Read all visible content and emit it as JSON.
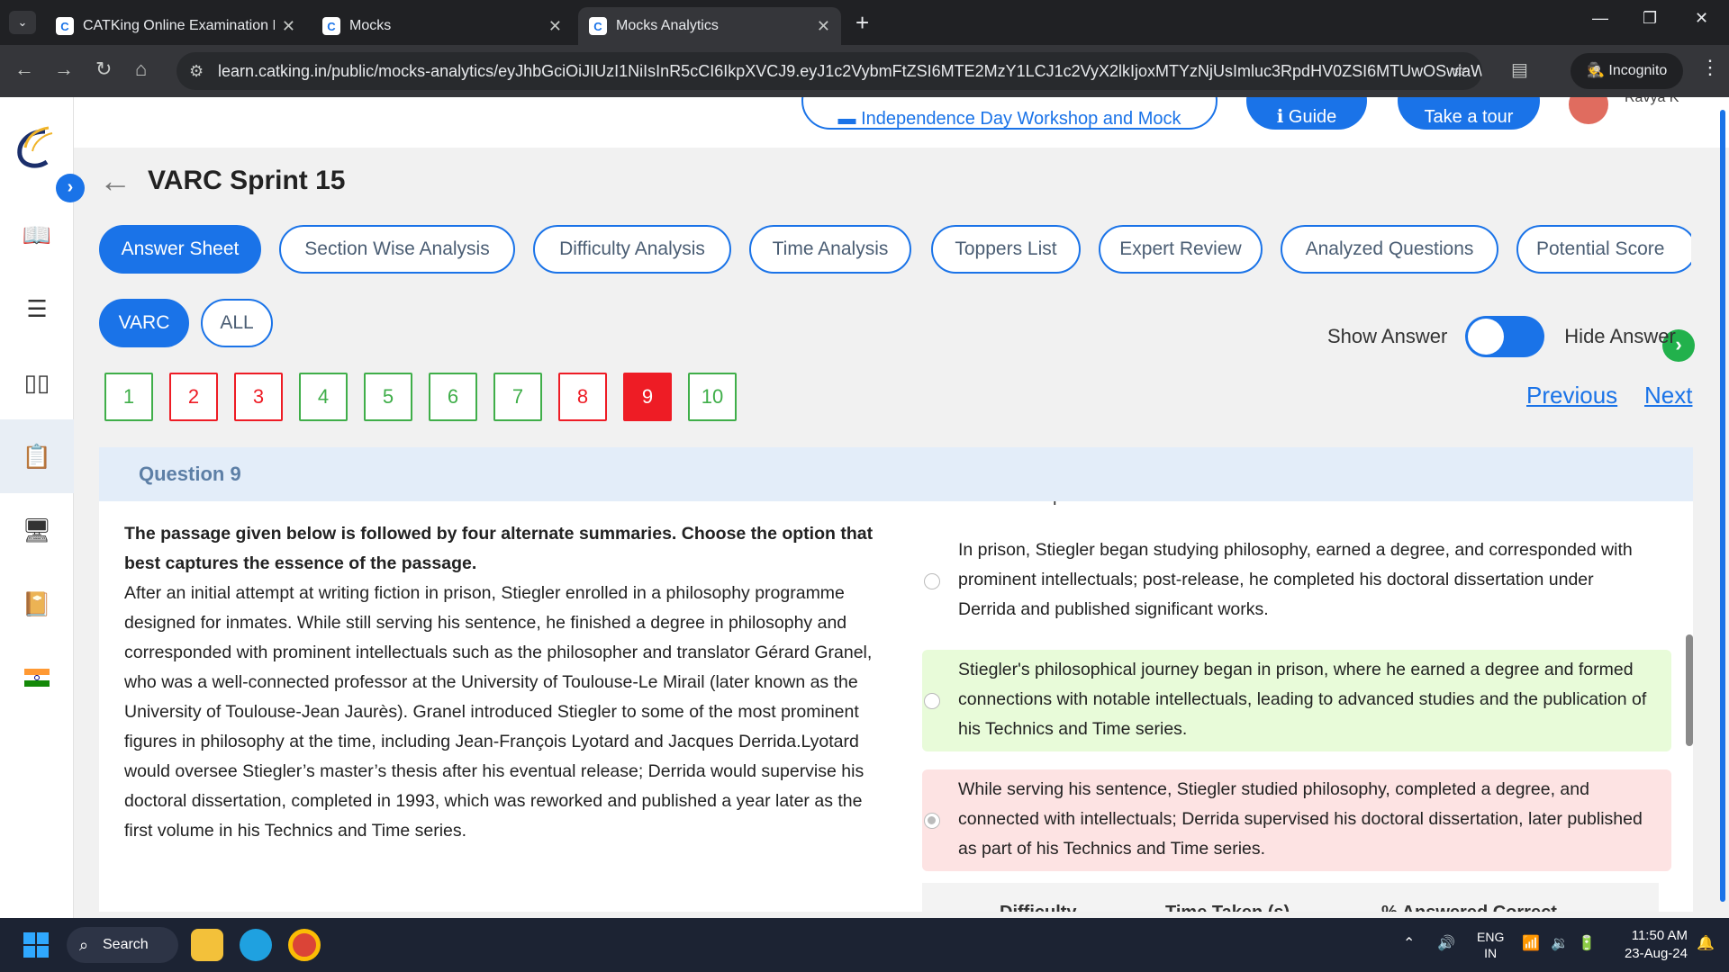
{
  "browser": {
    "tabs": [
      {
        "title": "CATKing Online Examination Pl",
        "active": false
      },
      {
        "title": "Mocks",
        "active": false
      },
      {
        "title": "Mocks Analytics",
        "active": true
      }
    ],
    "url": "learn.catking.in/public/mocks-analytics/eyJhbGciOiJIUzI1NiIsInR5cCI6IkpXVCJ9.eyJ1c2VybmFtZSI6MTE2MzY1LCJ1c2VyX2lkIjoxMTYzNjUsImluc3RpdHV0ZSI6MTUwOSwiaWQiO...",
    "mode_label": "Incognito"
  },
  "top_buttons": {
    "workshop": "Independence Day Workshop and Mock",
    "guide": "Guide",
    "tour": "Take a tour",
    "user": "Ravya K"
  },
  "page": {
    "title": "VARC Sprint 15",
    "analysis_tabs": [
      "Answer Sheet",
      "Section Wise Analysis",
      "Difficulty Analysis",
      "Time Analysis",
      "Toppers List",
      "Expert Review",
      "Analyzed Questions",
      "Potential Score"
    ],
    "section_filters": [
      "VARC",
      "ALL"
    ],
    "show_answer_label": "Show Answer",
    "hide_answer_label": "Hide Answer",
    "question_numbers": [
      {
        "n": "1",
        "status": "correct"
      },
      {
        "n": "2",
        "status": "wrong"
      },
      {
        "n": "3",
        "status": "wrong"
      },
      {
        "n": "4",
        "status": "correct"
      },
      {
        "n": "5",
        "status": "correct"
      },
      {
        "n": "6",
        "status": "correct"
      },
      {
        "n": "7",
        "status": "correct"
      },
      {
        "n": "8",
        "status": "wrong"
      },
      {
        "n": "9",
        "status": "current"
      },
      {
        "n": "10",
        "status": "correct"
      }
    ],
    "previous_label": "Previous",
    "next_label": "Next",
    "question_header": "Question 9"
  },
  "question": {
    "instruction": "The passage given below is followed by four alternate summaries. Choose the option that best captures the essence of the passage.",
    "passage": "After an initial attempt at writing fiction in prison, Stiegler enrolled in a philosophy programme designed for inmates. While still serving his sentence, he finished a degree in philosophy and corresponded with prominent intellectuals such as the philosopher and translator Gérard Granel, who was a well-connected professor at the University of Toulouse-Le Mirail (later known as the University of Toulouse-Jean Jaurès). Granel introduced Stiegler to some of the most prominent figures in philosophy at the time, including Jean-François Lyotard and Jacques Derrida.Lyotard would oversee Stiegler’s master’s thesis after his eventual release; Derrida would supervise his doctoral dissertation, completed in 1993, which was reworked and published a year later as the first volume in his Technics and Time series.",
    "option_partial": "studies and publications.",
    "options": [
      {
        "text": "In prison, Stiegler began studying philosophy, earned a degree, and corresponded with prominent intellectuals; post-release, he completed his doctoral dissertation under Derrida and published significant works.",
        "state": "neutral",
        "selected": false
      },
      {
        "text": "Stiegler's philosophical journey began in prison, where he earned a degree and formed connections with notable intellectuals, leading to advanced studies and the publication of his Technics and Time series.",
        "state": "correct",
        "selected": false
      },
      {
        "text": "While serving his sentence, Stiegler studied philosophy, completed a degree, and connected with intellectuals; Derrida supervised his doctoral dissertation, later published as part of his Technics and Time series.",
        "state": "wrong",
        "selected": true
      }
    ],
    "stats_headers": [
      "Difficulty",
      "Time Taken (s)",
      "% Answered Correct"
    ]
  },
  "taskbar": {
    "search_label": "Search",
    "lang": "ENG",
    "region": "IN",
    "time": "11:50 AM",
    "date": "23-Aug-24"
  },
  "colors": {
    "primary": "#1a73e8",
    "correct": "#3fae49",
    "wrong": "#ee1c25",
    "correct_bg": "#e8fbd9",
    "wrong_bg": "#fde3e3"
  }
}
